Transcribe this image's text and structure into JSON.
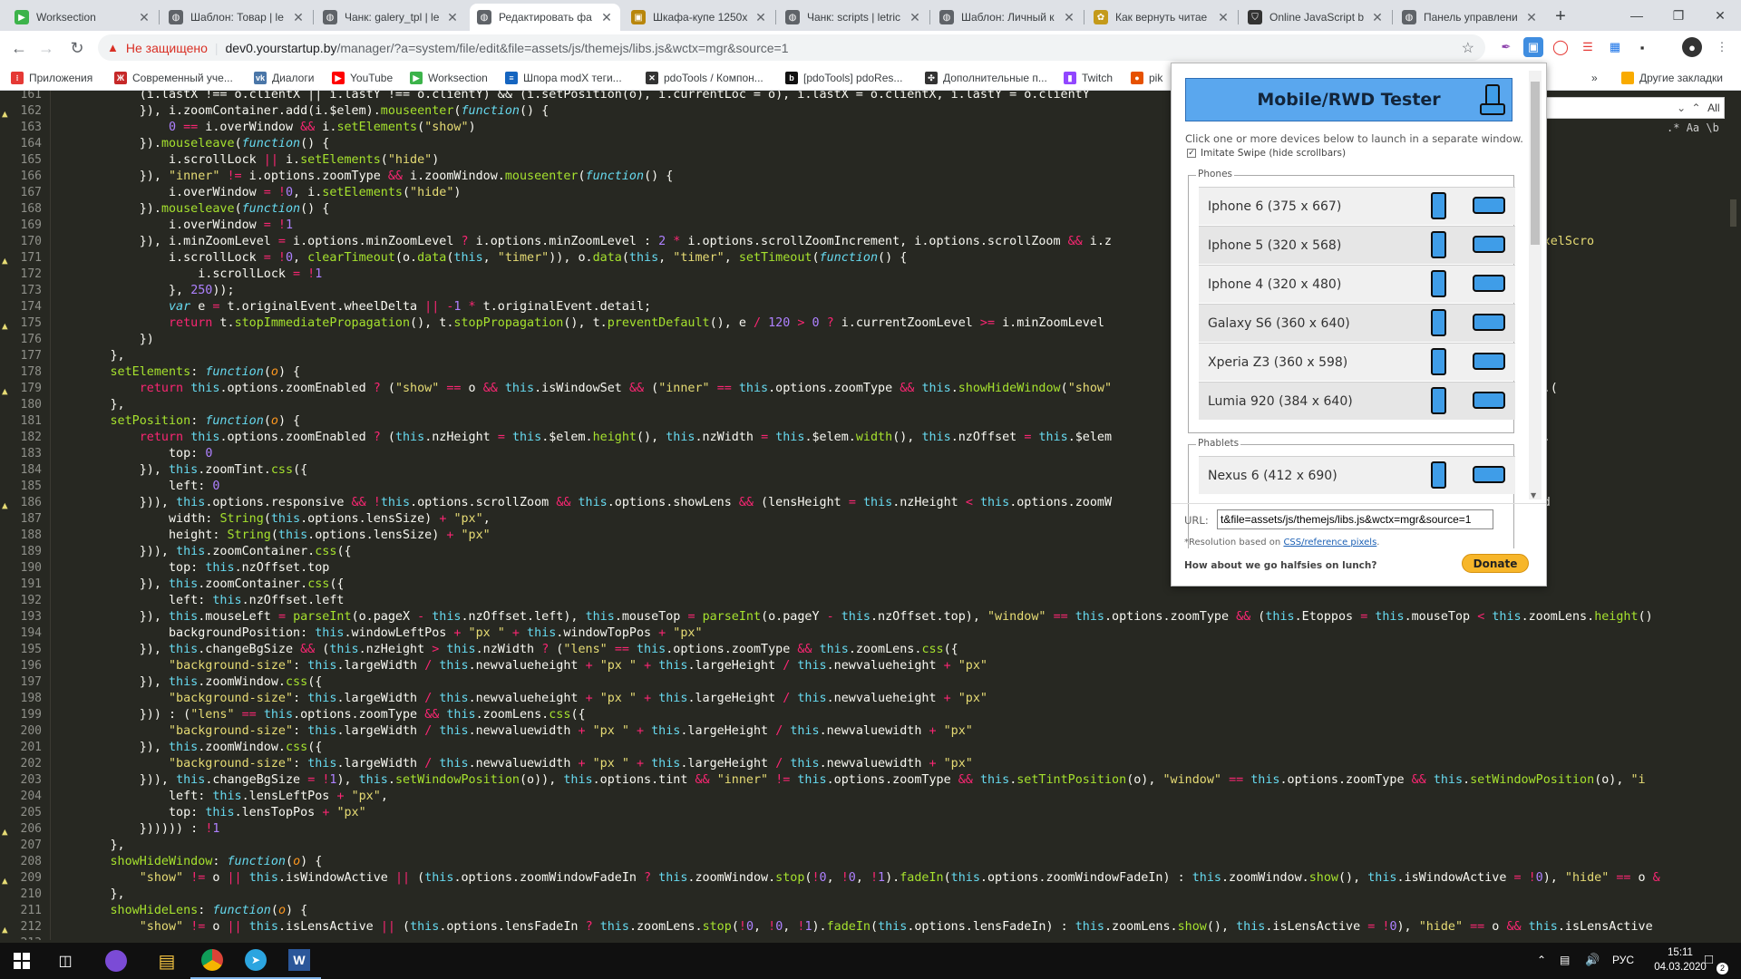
{
  "tabs": [
    {
      "title": "Worksection",
      "icon": "worksection-icon",
      "color": "#3cb34a",
      "glyph": "▶"
    },
    {
      "title": "Шаблон: Товар | le",
      "icon": "globe-icon",
      "color": "#5f6368",
      "glyph": "◍"
    },
    {
      "title": "Чанк: galery_tpl | le",
      "icon": "globe-icon",
      "color": "#5f6368",
      "glyph": "◍"
    },
    {
      "title": "Редактировать фа",
      "icon": "globe-icon",
      "color": "#5f6368",
      "glyph": "◍",
      "active": true
    },
    {
      "title": "Шкафа-купе 1250x",
      "icon": "image-icon",
      "color": "#b8860b",
      "glyph": "▣"
    },
    {
      "title": "Чанк: scripts | letric",
      "icon": "globe-icon",
      "color": "#5f6368",
      "glyph": "◍"
    },
    {
      "title": "Шаблон: Личный к",
      "icon": "globe-icon",
      "color": "#5f6368",
      "glyph": "◍"
    },
    {
      "title": "Как вернуть читае",
      "icon": "leaf-icon",
      "color": "#c49a1a",
      "glyph": "✿"
    },
    {
      "title": "Online JavaScript b",
      "icon": "shield-icon",
      "color": "#333",
      "glyph": "⛉"
    },
    {
      "title": "Панель управлени",
      "icon": "globe-icon",
      "color": "#5f6368",
      "glyph": "◍"
    }
  ],
  "new_tab_label": "+",
  "omnibox": {
    "security_label": "Не защищено",
    "host": "dev0.yourstartup.by",
    "path": "/manager/?a=system/file/edit&file=assets/js/themejs/libs.js&wctx=mgr&source=1"
  },
  "bookmarks": [
    {
      "label": "Приложения",
      "color": "#e53935",
      "glyph": "⁝"
    },
    {
      "label": "Современный уче...",
      "color": "#c62828",
      "glyph": "Ж"
    },
    {
      "label": "Диалоги",
      "color": "#4a76a8",
      "glyph": "vk"
    },
    {
      "label": "YouTube",
      "color": "#ff0000",
      "glyph": "▶"
    },
    {
      "label": "Worksection",
      "color": "#3cb34a",
      "glyph": "▶"
    },
    {
      "label": "Шпора modX теги...",
      "color": "#1565c0",
      "glyph": "≡"
    },
    {
      "label": "pdoTools / Компон...",
      "color": "#333333",
      "glyph": "✕"
    },
    {
      "label": "[pdoTools] pdoRes...",
      "color": "#111111",
      "glyph": "b"
    },
    {
      "label": "Дополнительные п...",
      "color": "#333333",
      "glyph": "✣"
    },
    {
      "label": "Twitch",
      "color": "#9146ff",
      "glyph": "▮"
    },
    {
      "label": "pik",
      "color": "#e65100",
      "glyph": "●"
    }
  ],
  "other_bookmarks": "Другие закладки",
  "bookmarks_more": "»",
  "find": {
    "all_label": "All",
    "opt_regex": ".*",
    "opt_case": "Aa",
    "opt_word": "\"Aa\"",
    "opt_b": "\\b"
  },
  "code_lines": [
    {
      "n": "161",
      "w": false,
      "h": "            (i.lastX !== o.clientX || i.lastY !== o.clientY) && (i.setPosition(o), i.currentLoc = o), i.lastX = o.clientX, i.lastY = o.clientY"
    },
    {
      "n": "162",
      "w": true,
      "h": "            }), i.zoomContainer.add(i.$elem).<span class=\"f\">mouseenter</span>(<span class=\"fi\">function</span>() {"
    },
    {
      "n": "163",
      "w": false,
      "h": "                <span class=\"n\">0</span> <span class=\"k\">==</span> i.overWindow <span class=\"k\">&amp;&amp;</span> i.<span class=\"f\">setElements</span>(<span class=\"s\">\"show\"</span>)"
    },
    {
      "n": "164",
      "w": false,
      "h": "            }).<span class=\"f\">mouseleave</span>(<span class=\"fi\">function</span>() {"
    },
    {
      "n": "165",
      "w": false,
      "h": "                i.scrollLock <span class=\"k\">||</span> i.<span class=\"f\">setElements</span>(<span class=\"s\">\"hide\"</span>)"
    },
    {
      "n": "166",
      "w": false,
      "h": "            }), <span class=\"s\">\"inner\"</span> <span class=\"k\">!=</span> i.options.zoomType <span class=\"k\">&amp;&amp;</span> i.zoomWindow.<span class=\"f\">mouseenter</span>(<span class=\"fi\">function</span>() {"
    },
    {
      "n": "167",
      "w": false,
      "h": "                i.overWindow <span class=\"k\">=</span> <span class=\"k\">!</span><span class=\"n\">0</span>, i.<span class=\"f\">setElements</span>(<span class=\"s\">\"hide\"</span>)"
    },
    {
      "n": "168",
      "w": false,
      "h": "            }).<span class=\"f\">mouseleave</span>(<span class=\"fi\">function</span>() {"
    },
    {
      "n": "169",
      "w": false,
      "h": "                i.overWindow <span class=\"k\">=</span> <span class=\"k\">!</span><span class=\"n\">1</span>"
    },
    {
      "n": "170",
      "w": false,
      "h": "            }), i.minZoomLevel <span class=\"k\">=</span> i.options.minZoomLevel <span class=\"k\">?</span> i.options.minZoomLevel : <span class=\"n\">2</span> <span class=\"k\">*</span> i.options.scrollZoomIncrement, i.options.scrollZoom <span class=\"k\">&amp;&amp;</span> i.z                                         <span class=\"s\">eScroll MozMousePixelScro</span>"
    },
    {
      "n": "171",
      "w": true,
      "h": "                i.scrollLock <span class=\"k\">=</span> <span class=\"k\">!</span><span class=\"n\">0</span>, <span class=\"f\">clearTimeout</span>(o.<span class=\"f\">data</span>(<span class=\"t\">this</span>, <span class=\"s\">\"timer\"</span>)), o.<span class=\"f\">data</span>(<span class=\"t\">this</span>, <span class=\"s\">\"timer\"</span>, <span class=\"f\">setTimeout</span>(<span class=\"fi\">function</span>() {"
    },
    {
      "n": "172",
      "w": false,
      "h": "                    i.scrollLock <span class=\"k\">=</span> <span class=\"k\">!</span><span class=\"n\">1</span>"
    },
    {
      "n": "173",
      "w": false,
      "h": "                }, <span class=\"n\">250</span>));"
    },
    {
      "n": "174",
      "w": false,
      "h": "                <span class=\"fi\">var</span> e <span class=\"k\">=</span> t.originalEvent.wheelDelta <span class=\"k\">||</span> <span class=\"k\">-</span><span class=\"n\">1</span> <span class=\"k\">*</span> t.originalEvent.detail;"
    },
    {
      "n": "175",
      "w": true,
      "h": "                <span class=\"k\">return</span> t.<span class=\"f\">stopImmediatePropagation</span>(), t.<span class=\"f\">stopPropagation</span>(), t.<span class=\"f\">preventDefault</span>(), e <span class=\"k\">/</span> <span class=\"n\">120</span> <span class=\"k\">&gt;</span> <span class=\"n\">0</span> <span class=\"k\">?</span> i.currentZoomLevel <span class=\"k\">&gt;=</span> i.minZoomLevel                                   s.scrollZoomIncrement) :"
    },
    {
      "n": "176",
      "w": false,
      "h": "            })"
    },
    {
      "n": "177",
      "w": false,
      "h": "        },"
    },
    {
      "n": "178",
      "w": false,
      "h": "        <span class=\"f\">setElements</span>: <span class=\"fi\">function</span>(<span class=\"p\">o</span>) {"
    },
    {
      "n": "179",
      "w": true,
      "h": "            <span class=\"k\">return</span> <span class=\"t\">this</span>.options.zoomEnabled <span class=\"k\">?</span> (<span class=\"s\">\"show\"</span> <span class=\"k\">==</span> o <span class=\"k\">&amp;&amp;</span> <span class=\"t\">this</span>.isWindowSet <span class=\"k\">&amp;&amp;</span> (<span class=\"s\">\"inner\"</span> <span class=\"k\">==</span> <span class=\"t\">this</span>.options.zoomType <span class=\"k\">&amp;&amp;</span> <span class=\"t\">this</span>.<span class=\"f\">showHideWindow</span>(<span class=\"s\">\"show\"</span>                                    <span class=\"f\">ideWindow</span>(<span class=\"s\">\"show\"</span>), <span class=\"t\">this</span>.("
    },
    {
      "n": "180",
      "w": false,
      "h": "        },"
    },
    {
      "n": "181",
      "w": false,
      "h": "        <span class=\"f\">setPosition</span>: <span class=\"fi\">function</span>(<span class=\"p\">o</span>) {"
    },
    {
      "n": "182",
      "w": false,
      "h": "            <span class=\"k\">return</span> <span class=\"t\">this</span>.options.zoomEnabled <span class=\"k\">?</span> (<span class=\"t\">this</span>.nzHeight <span class=\"k\">=</span> <span class=\"t\">this</span>.$elem.<span class=\"f\">height</span>(), <span class=\"t\">this</span>.nzWidth <span class=\"k\">=</span> <span class=\"t\">this</span>.$elem.<span class=\"f\">width</span>(), <span class=\"t\">this</span>.nzOffset <span class=\"k\">=</span> <span class=\"t\">this</span>.$elem                                   ptions.zoomType <span class=\"k\">&amp;&amp;</span> (<span class=\"t\">this</span>."
    },
    {
      "n": "183",
      "w": false,
      "h": "                top: <span class=\"n\">0</span>"
    },
    {
      "n": "184",
      "w": false,
      "h": "            }), <span class=\"t\">this</span>.zoomTint.<span class=\"f\">css</span>({"
    },
    {
      "n": "185",
      "w": false,
      "h": "                left: <span class=\"n\">0</span>"
    },
    {
      "n": "186",
      "w": true,
      "h": "            })), <span class=\"t\">this</span>.options.responsive <span class=\"k\">&amp;&amp;</span> <span class=\"k\">!</span><span class=\"t\">this</span>.options.scrollZoom <span class=\"k\">&amp;&amp;</span> <span class=\"t\">this</span>.options.showLens <span class=\"k\">&amp;&amp;</span> (lensHeight <span class=\"k\">=</span> <span class=\"t\">this</span>.nzHeight <span class=\"k\">&lt;</span> <span class=\"t\">this</span>.options.zoomW                                   <span class=\"f\">ing</span>(<span class=\"t\">this</span>.options.zoomWind"
    },
    {
      "n": "187",
      "w": false,
      "h": "                width: <span class=\"f\">String</span>(<span class=\"t\">this</span>.options.lensSize) <span class=\"k\">+</span> <span class=\"s\">\"px\"</span>,"
    },
    {
      "n": "188",
      "w": false,
      "h": "                height: <span class=\"f\">String</span>(<span class=\"t\">this</span>.options.lensSize) <span class=\"k\">+</span> <span class=\"s\">\"px\"</span>"
    },
    {
      "n": "189",
      "w": false,
      "h": "            })), <span class=\"t\">this</span>.zoomContainer.<span class=\"f\">css</span>({"
    },
    {
      "n": "190",
      "w": false,
      "h": "                top: <span class=\"t\">this</span>.nzOffset.top"
    },
    {
      "n": "191",
      "w": false,
      "h": "            }), <span class=\"t\">this</span>.zoomContainer.<span class=\"f\">css</span>({"
    },
    {
      "n": "192",
      "w": false,
      "h": "                left: <span class=\"t\">this</span>.nzOffset.left"
    },
    {
      "n": "193",
      "w": false,
      "h": "            }), <span class=\"t\">this</span>.mouseLeft <span class=\"k\">=</span> <span class=\"f\">parseInt</span>(o.pageX <span class=\"k\">-</span> <span class=\"t\">this</span>.nzOffset.left), <span class=\"t\">this</span>.mouseTop <span class=\"k\">=</span> <span class=\"f\">parseInt</span>(o.pageY <span class=\"k\">-</span> <span class=\"t\">this</span>.nzOffset.top), <span class=\"s\">\"window\"</span> <span class=\"k\">==</span> <span class=\"t\">this</span>.options.zoomType <span class=\"k\">&amp;&amp;</span> (<span class=\"t\">this</span>.Etoppos <span class=\"k\">=</span> <span class=\"t\">this</span>.mouseTop <span class=\"k\">&lt;</span> <span class=\"t\">this</span>.zoomLens.<span class=\"f\">height</span>()"
    },
    {
      "n": "194",
      "w": false,
      "h": "                backgroundPosition: <span class=\"t\">this</span>.windowLeftPos <span class=\"k\">+</span> <span class=\"s\">\"px \"</span> <span class=\"k\">+</span> <span class=\"t\">this</span>.windowTopPos <span class=\"k\">+</span> <span class=\"s\">\"px\"</span>"
    },
    {
      "n": "195",
      "w": false,
      "h": "            }), <span class=\"t\">this</span>.changeBgSize <span class=\"k\">&amp;&amp;</span> (<span class=\"t\">this</span>.nzHeight <span class=\"k\">&gt;</span> <span class=\"t\">this</span>.nzWidth <span class=\"k\">?</span> (<span class=\"s\">\"lens\"</span> <span class=\"k\">==</span> <span class=\"t\">this</span>.options.zoomType <span class=\"k\">&amp;&amp;</span> <span class=\"t\">this</span>.zoomLens.<span class=\"f\">css</span>({"
    },
    {
      "n": "196",
      "w": false,
      "h": "                <span class=\"s\">\"background-size\"</span>: <span class=\"t\">this</span>.largeWidth <span class=\"k\">/</span> <span class=\"t\">this</span>.newvalueheight <span class=\"k\">+</span> <span class=\"s\">\"px \"</span> <span class=\"k\">+</span> <span class=\"t\">this</span>.largeHeight <span class=\"k\">/</span> <span class=\"t\">this</span>.newvalueheight <span class=\"k\">+</span> <span class=\"s\">\"px\"</span>"
    },
    {
      "n": "197",
      "w": false,
      "h": "            }), <span class=\"t\">this</span>.zoomWindow.<span class=\"f\">css</span>({"
    },
    {
      "n": "198",
      "w": false,
      "h": "                <span class=\"s\">\"background-size\"</span>: <span class=\"t\">this</span>.largeWidth <span class=\"k\">/</span> <span class=\"t\">this</span>.newvalueheight <span class=\"k\">+</span> <span class=\"s\">\"px \"</span> <span class=\"k\">+</span> <span class=\"t\">this</span>.largeHeight <span class=\"k\">/</span> <span class=\"t\">this</span>.newvalueheight <span class=\"k\">+</span> <span class=\"s\">\"px\"</span>"
    },
    {
      "n": "199",
      "w": false,
      "h": "            })) : (<span class=\"s\">\"lens\"</span> <span class=\"k\">==</span> <span class=\"t\">this</span>.options.zoomType <span class=\"k\">&amp;&amp;</span> <span class=\"t\">this</span>.zoomLens.<span class=\"f\">css</span>({"
    },
    {
      "n": "200",
      "w": false,
      "h": "                <span class=\"s\">\"background-size\"</span>: <span class=\"t\">this</span>.largeWidth <span class=\"k\">/</span> <span class=\"t\">this</span>.newvaluewidth <span class=\"k\">+</span> <span class=\"s\">\"px \"</span> <span class=\"k\">+</span> <span class=\"t\">this</span>.largeHeight <span class=\"k\">/</span> <span class=\"t\">this</span>.newvaluewidth <span class=\"k\">+</span> <span class=\"s\">\"px\"</span>"
    },
    {
      "n": "201",
      "w": false,
      "h": "            }), <span class=\"t\">this</span>.zoomWindow.<span class=\"f\">css</span>({"
    },
    {
      "n": "202",
      "w": false,
      "h": "                <span class=\"s\">\"background-size\"</span>: <span class=\"t\">this</span>.largeWidth <span class=\"k\">/</span> <span class=\"t\">this</span>.newvaluewidth <span class=\"k\">+</span> <span class=\"s\">\"px \"</span> <span class=\"k\">+</span> <span class=\"t\">this</span>.largeHeight <span class=\"k\">/</span> <span class=\"t\">this</span>.newvaluewidth <span class=\"k\">+</span> <span class=\"s\">\"px\"</span>"
    },
    {
      "n": "203",
      "w": false,
      "h": "            })), <span class=\"t\">this</span>.changeBgSize <span class=\"k\">=</span> <span class=\"k\">!</span><span class=\"n\">1</span>), <span class=\"t\">this</span>.<span class=\"f\">setWindowPosition</span>(o)), <span class=\"t\">this</span>.options.tint <span class=\"k\">&amp;&amp;</span> <span class=\"s\">\"inner\"</span> <span class=\"k\">!=</span> <span class=\"t\">this</span>.options.zoomType <span class=\"k\">&amp;&amp;</span> <span class=\"t\">this</span>.<span class=\"f\">setTintPosition</span>(o), <span class=\"s\">\"window\"</span> <span class=\"k\">==</span> <span class=\"t\">this</span>.options.zoomType <span class=\"k\">&amp;&amp;</span> <span class=\"t\">this</span>.<span class=\"f\">setWindowPosition</span>(o), <span class=\"s\">\"i</span>"
    },
    {
      "n": "204",
      "w": false,
      "h": "                left: <span class=\"t\">this</span>.lensLeftPos <span class=\"k\">+</span> <span class=\"s\">\"px\"</span>,"
    },
    {
      "n": "205",
      "w": false,
      "h": "                top: <span class=\"t\">this</span>.lensTopPos <span class=\"k\">+</span> <span class=\"s\">\"px\"</span>"
    },
    {
      "n": "206",
      "w": true,
      "h": "            }))))) : <span class=\"k\">!</span><span class=\"n\">1</span>"
    },
    {
      "n": "207",
      "w": false,
      "h": "        },"
    },
    {
      "n": "208",
      "w": false,
      "h": "        <span class=\"f\">showHideWindow</span>: <span class=\"fi\">function</span>(<span class=\"p\">o</span>) {"
    },
    {
      "n": "209",
      "w": true,
      "h": "            <span class=\"s\">\"show\"</span> <span class=\"k\">!=</span> o <span class=\"k\">||</span> <span class=\"t\">this</span>.isWindowActive <span class=\"k\">||</span> (<span class=\"t\">this</span>.options.zoomWindowFadeIn <span class=\"k\">?</span> <span class=\"t\">this</span>.zoomWindow.<span class=\"f\">stop</span>(<span class=\"k\">!</span><span class=\"n\">0</span>, <span class=\"k\">!</span><span class=\"n\">0</span>, <span class=\"k\">!</span><span class=\"n\">1</span>).<span class=\"f\">fadeIn</span>(<span class=\"t\">this</span>.options.zoomWindowFadeIn) : <span class=\"t\">this</span>.zoomWindow.<span class=\"f\">show</span>(), <span class=\"t\">this</span>.isWindowActive <span class=\"k\">=</span> <span class=\"k\">!</span><span class=\"n\">0</span>), <span class=\"s\">\"hide\"</span> <span class=\"k\">==</span> o <span class=\"k\">&amp;</span>"
    },
    {
      "n": "210",
      "w": false,
      "h": "        },"
    },
    {
      "n": "211",
      "w": false,
      "h": "        <span class=\"f\">showHideLens</span>: <span class=\"fi\">function</span>(<span class=\"p\">o</span>) {"
    },
    {
      "n": "212",
      "w": true,
      "h": "            <span class=\"s\">\"show\"</span> <span class=\"k\">!=</span> o <span class=\"k\">||</span> <span class=\"t\">this</span>.isLensActive <span class=\"k\">||</span> (<span class=\"t\">this</span>.options.lensFadeIn <span class=\"k\">?</span> <span class=\"t\">this</span>.zoomLens.<span class=\"f\">stop</span>(<span class=\"k\">!</span><span class=\"n\">0</span>, <span class=\"k\">!</span><span class=\"n\">0</span>, <span class=\"k\">!</span><span class=\"n\">1</span>).<span class=\"f\">fadeIn</span>(<span class=\"t\">this</span>.options.lensFadeIn) : <span class=\"t\">this</span>.zoomLens.<span class=\"f\">show</span>(), <span class=\"t\">this</span>.isLensActive <span class=\"k\">=</span> <span class=\"k\">!</span><span class=\"n\">0</span>), <span class=\"s\">\"hide\"</span> <span class=\"k\">==</span> o <span class=\"k\">&amp;&amp;</span> <span class=\"t\">this</span>.isLensActive"
    },
    {
      "n": "213",
      "w": false,
      "h": ""
    }
  ],
  "popup": {
    "title": "Mobile/RWD Tester",
    "instructions": "Click one or more devices below to launch in a separate window.",
    "swipe_label": "Imitate Swipe (hide scrollbars)",
    "phones_legend": "Phones",
    "phones": [
      "Iphone 6 (375 x 667)",
      "Iphone 5 (320 x 568)",
      "Iphone 4 (320 x 480)",
      "Galaxy S6 (360 x 640)",
      "Xperia Z3 (360 x 598)",
      "Lumia 920 (384 x 640)"
    ],
    "phablets_legend": "Phablets",
    "phablets": [
      "Nexus 6 (412 x 690)"
    ],
    "url_label": "URL:",
    "url_value": "t&file=assets/js/themejs/libs.js&wctx=mgr&source=1",
    "resolution_prefix": "*Resolution based on ",
    "resolution_link": "CSS/reference pixels",
    "resolution_suffix": ".",
    "halfsies": "How about we go halfsies on lunch?",
    "donate": "Donate",
    "accent": "#5aa7ee",
    "donate_color": "#f7b62a"
  },
  "taskbar": {
    "lang": "РУС",
    "time": "15:11",
    "date": "04.03.2020",
    "notif_count": "2"
  }
}
